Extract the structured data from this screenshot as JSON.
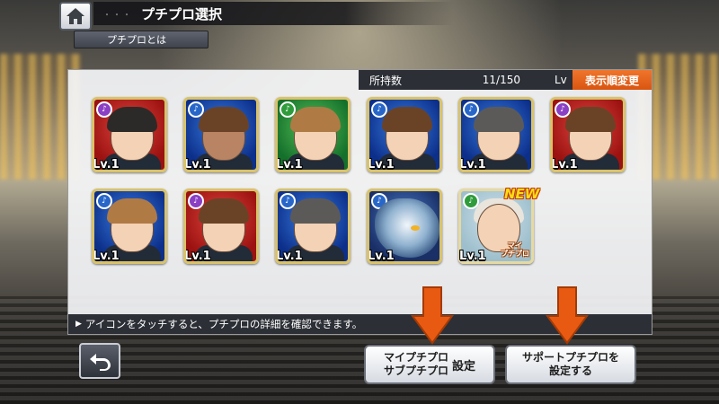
{
  "header": {
    "title": "プチプロ選択",
    "dots": "・・・",
    "about_label": "プチプロとは"
  },
  "panel": {
    "owned_label": "所持数",
    "owned_count": "11/150",
    "level_label": "Lv",
    "sort_label": "表示順変更",
    "hint": "アイコンをタッチすると、プチプロの詳細を確認できます。"
  },
  "cards": [
    {
      "level": "Lv.1",
      "frame": "red",
      "attribute": "purple"
    },
    {
      "level": "Lv.1",
      "frame": "blue",
      "attribute": "blue"
    },
    {
      "level": "Lv.1",
      "frame": "green",
      "attribute": "green"
    },
    {
      "level": "Lv.1",
      "frame": "blue",
      "attribute": "blue"
    },
    {
      "level": "Lv.1",
      "frame": "blue",
      "attribute": "blue"
    },
    {
      "level": "Lv.1",
      "frame": "red",
      "attribute": "purple"
    },
    {
      "level": "Lv.1",
      "frame": "blue",
      "attribute": "blue"
    },
    {
      "level": "Lv.1",
      "frame": "red",
      "attribute": "purple"
    },
    {
      "level": "Lv.1",
      "frame": "blue",
      "attribute": "blue"
    },
    {
      "level": "Lv.1",
      "frame": "navy",
      "attribute": "blue"
    },
    {
      "level": "Lv.1",
      "frame": "teal",
      "attribute": "green",
      "badge": "NEW",
      "tag": "マイ\nプチプロ"
    }
  ],
  "buttons": {
    "my_line1": "マイプチプロ",
    "my_line2": "サブプチプロ",
    "my_side": "設定",
    "support_line1": "サポートプチプロを",
    "support_line2": "設定する"
  },
  "colors": {
    "accent_orange": "#e5621c",
    "bar_dark": "#2c2f36"
  }
}
